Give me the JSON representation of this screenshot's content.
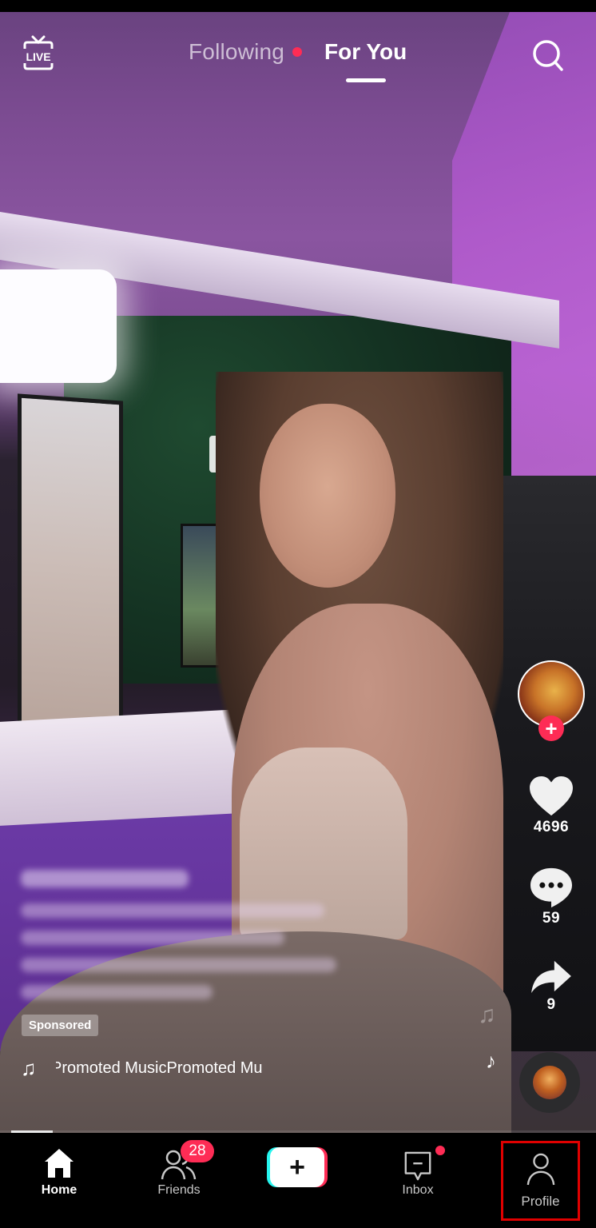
{
  "app": "TikTok",
  "top_nav": {
    "live_label": "LIVE",
    "tabs": [
      {
        "label": "Following",
        "active": false,
        "has_notification_dot": true
      },
      {
        "label": "For You",
        "active": true
      }
    ],
    "search_icon": "search-icon"
  },
  "video": {
    "creator_avatar": "creator-avatar",
    "follow_symbol": "+",
    "actions": {
      "likes": "4696",
      "comments": "59",
      "shares": "9"
    },
    "caption_blurred": true,
    "sponsored_label": "Sponsored",
    "music": {
      "icon": "music-note-icon",
      "track_text": "Promoted MusicPromoted Mu"
    },
    "progress_fraction": 0.07
  },
  "bottom_nav": {
    "items": [
      {
        "label": "Home",
        "active": true
      },
      {
        "label": "Friends",
        "badge": "28"
      },
      {
        "label": "",
        "icon": "create-plus-icon",
        "symbol": "+"
      },
      {
        "label": "Inbox",
        "has_notification_dot": true
      },
      {
        "label": "Profile",
        "highlighted": true
      }
    ]
  },
  "colors": {
    "accent_red": "#fe2c55",
    "accent_cyan": "#25f4ee",
    "highlight_box": "#e00000"
  }
}
